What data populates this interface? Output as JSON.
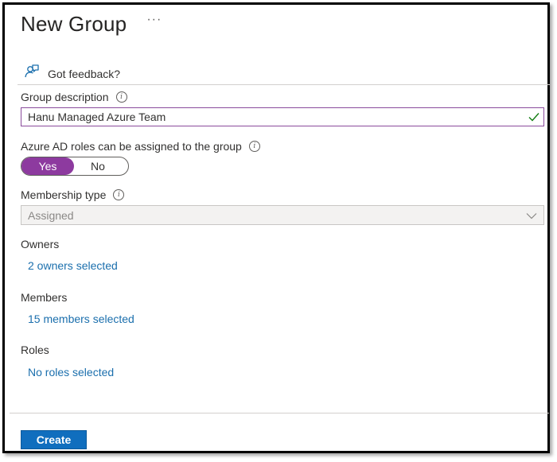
{
  "header": {
    "title": "New Group",
    "more_label": "···"
  },
  "feedback": {
    "label": "Got feedback?"
  },
  "group_description": {
    "label": "Group description",
    "value": "Hanu Managed Azure Team"
  },
  "roles_assignable": {
    "label": "Azure AD roles can be assigned to the group",
    "yes_label": "Yes",
    "no_label": "No",
    "selected": "Yes"
  },
  "membership_type": {
    "label": "Membership type",
    "value": "Assigned"
  },
  "owners": {
    "label": "Owners",
    "link": "2 owners selected"
  },
  "members": {
    "label": "Members",
    "link": "15 members selected"
  },
  "roles": {
    "label": "Roles",
    "link": "No roles selected"
  },
  "footer": {
    "create_label": "Create"
  },
  "colors": {
    "accent_purple": "#8d3a9f",
    "link_blue": "#1b6fad",
    "primary_button": "#106ebe",
    "valid_check": "#107c10"
  },
  "icons": {
    "feedback": "feedback-person-icon",
    "info": "info-icon",
    "check": "checkmark-icon",
    "dropdown": "chevron-down-icon"
  }
}
